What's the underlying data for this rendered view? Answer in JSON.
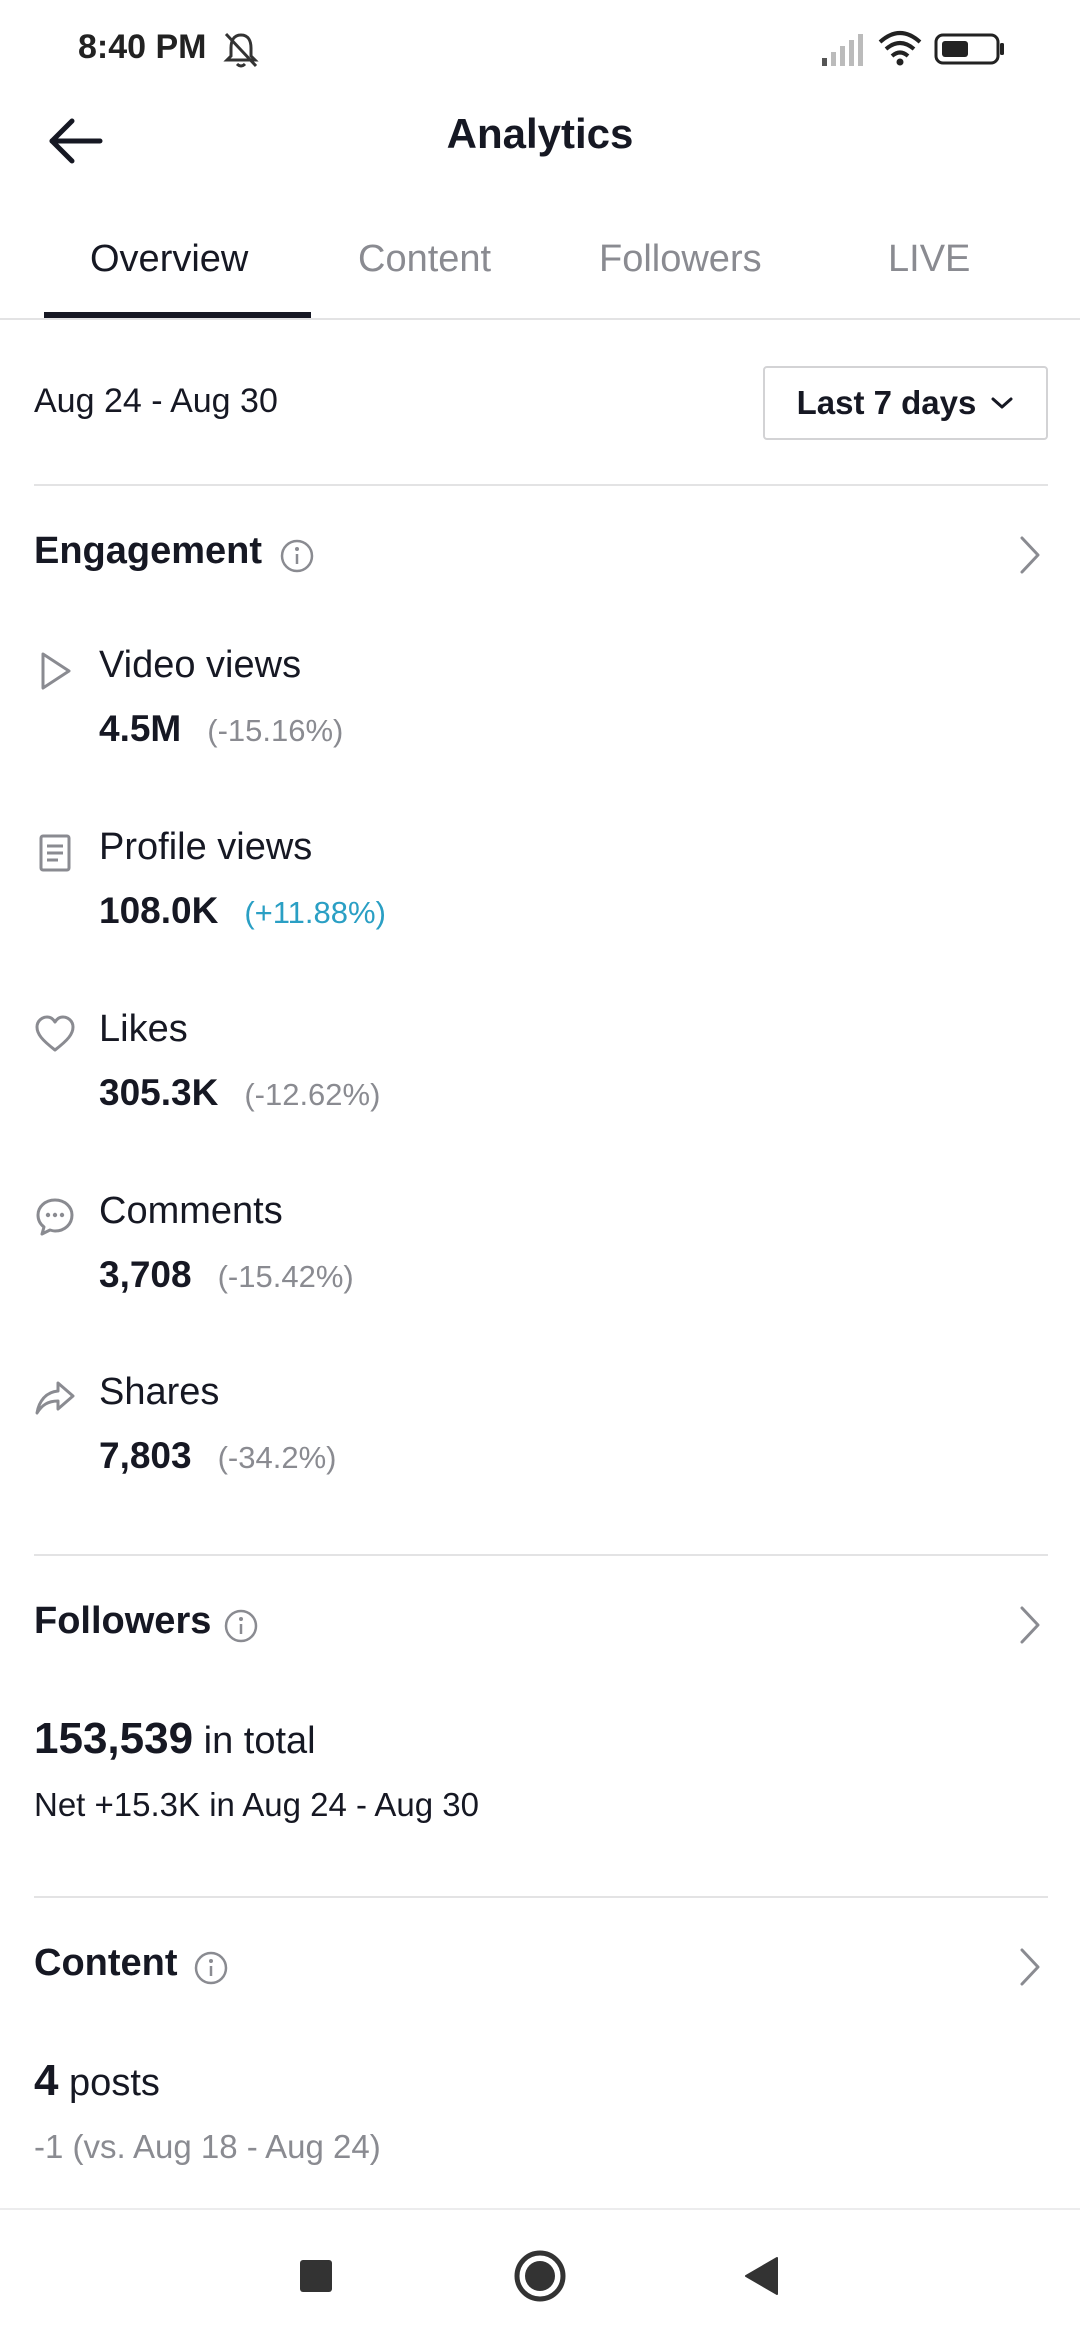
{
  "status_bar": {
    "time": "8:40 PM",
    "icons": [
      "bell-muted-icon",
      "signal-icon",
      "wifi-icon",
      "battery-icon"
    ]
  },
  "header": {
    "title": "Analytics",
    "back_icon": "arrow-left-icon"
  },
  "tabs": [
    {
      "label": "Overview",
      "active": true
    },
    {
      "label": "Content",
      "active": false
    },
    {
      "label": "Followers",
      "active": false
    },
    {
      "label": "LIVE",
      "active": false
    }
  ],
  "date_filter": {
    "range": "Aug 24 - Aug 30",
    "selected_period": "Last 7 days"
  },
  "engagement": {
    "title": "Engagement",
    "metrics": [
      {
        "label": "Video views",
        "value": "4.5M",
        "change": "(-15.16%)",
        "icon": "play-icon"
      },
      {
        "label": "Profile views",
        "value": "108.0K",
        "change": "(+11.88%)",
        "icon": "profile-card-icon"
      },
      {
        "label": "Likes",
        "value": "305.3K",
        "change": "(-12.62%)",
        "icon": "heart-icon"
      },
      {
        "label": "Comments",
        "value": "3,708",
        "change": "(-15.42%)",
        "icon": "comment-icon"
      },
      {
        "label": "Shares",
        "value": "7,803",
        "change": "(-34.2%)",
        "icon": "share-icon"
      }
    ]
  },
  "followers": {
    "title": "Followers",
    "total": "153,539",
    "total_suffix": "in total",
    "net": "Net +15.3K in Aug 24 - Aug 30"
  },
  "content": {
    "title": "Content",
    "posts": "4",
    "posts_suffix": "posts",
    "comparison": "-1 (vs. Aug 18 - Aug 24)"
  },
  "colors": {
    "text": "#161823",
    "muted": "#8a8b91",
    "positive": "#2a9fc4",
    "divider": "#e3e3e4"
  }
}
